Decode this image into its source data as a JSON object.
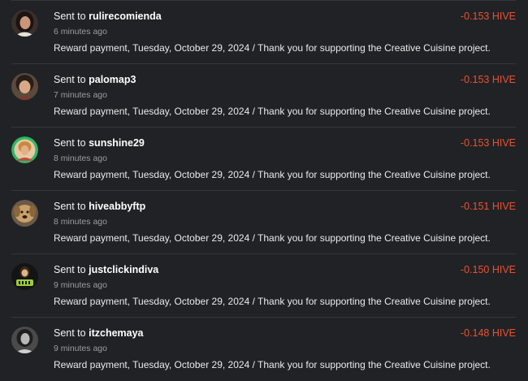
{
  "transfers": [
    {
      "prefix": "Sent to",
      "username": "rulirecomienda",
      "time": "6 minutes ago",
      "amount": "-0.153 HIVE",
      "memo": "Reward payment, Tuesday, October 29, 2024 / Thank you for supporting the Creative Cuisine project."
    },
    {
      "prefix": "Sent to",
      "username": "palomap3",
      "time": "7 minutes ago",
      "amount": "-0.153 HIVE",
      "memo": "Reward payment, Tuesday, October 29, 2024 / Thank you for supporting the Creative Cuisine project."
    },
    {
      "prefix": "Sent to",
      "username": "sunshine29",
      "time": "8 minutes ago",
      "amount": "-0.153 HIVE",
      "memo": "Reward payment, Tuesday, October 29, 2024 / Thank you for supporting the Creative Cuisine project."
    },
    {
      "prefix": "Sent to",
      "username": "hiveabbyftp",
      "time": "8 minutes ago",
      "amount": "-0.151 HIVE",
      "memo": "Reward payment, Tuesday, October 29, 2024 / Thank you for supporting the Creative Cuisine project."
    },
    {
      "prefix": "Sent to",
      "username": "justclickindiva",
      "time": "9 minutes ago",
      "amount": "-0.150 HIVE",
      "memo": "Reward payment, Tuesday, October 29, 2024 / Thank you for supporting the Creative Cuisine project."
    },
    {
      "prefix": "Sent to",
      "username": "itzchemaya",
      "time": "9 minutes ago",
      "amount": "-0.148 HIVE",
      "memo": "Reward payment, Tuesday, October 29, 2024 / Thank you for supporting the Creative Cuisine project."
    }
  ],
  "colors": {
    "background": "#212226",
    "amount": "#e8522f",
    "divider": "#34363b",
    "muted": "#9a9ca2"
  },
  "avatar_icons": [
    "avatar-woman-dark-hair-icon",
    "avatar-woman-curly-hair-icon",
    "avatar-woman-green-ring-icon",
    "avatar-dog-icon",
    "avatar-cartoon-hello-icon",
    "avatar-woman-grey-icon"
  ]
}
